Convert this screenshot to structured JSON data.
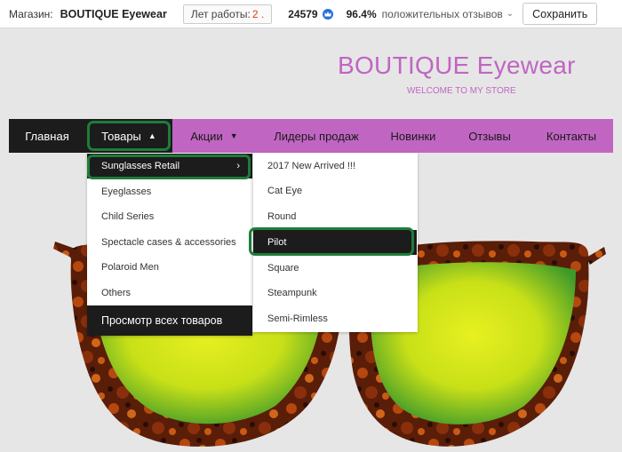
{
  "topbar": {
    "store_label": "Магазин:",
    "store_name": "BOUTIQUE Eyewear",
    "years_label": "Лет работы:",
    "years_value": "2 .",
    "score": "24579",
    "positive_pct": "96.4%",
    "positive_label": "положительных отзывов",
    "save_label": "Сохранить"
  },
  "brand": {
    "title": "BOUTIQUE Eyewear",
    "subtitle": "WELCOME TO MY STORE"
  },
  "nav": {
    "home": "Главная",
    "goods": "Товары",
    "sales": "Акции",
    "leaders": "Лидеры продаж",
    "new": "Новинки",
    "reviews": "Отзывы",
    "contacts": "Контакты"
  },
  "menu_categories": {
    "items": [
      "Sunglasses Retail",
      "Eyeglasses",
      "Child Series",
      "Spectacle cases & accessories",
      "Polaroid Men",
      "Others"
    ],
    "view_all": "Просмотр всех товаров"
  },
  "menu_sub": {
    "items": [
      "2017 New Arrived !!!",
      "Cat Eye",
      "Round",
      "Pilot",
      "Square",
      "Steampunk",
      "Semi-Rimless"
    ]
  },
  "colors": {
    "accent": "#c066c2",
    "nav_dark": "#1c1c1c",
    "highlight_ring": "#1e7d3a",
    "years_red": "#e53c12"
  }
}
